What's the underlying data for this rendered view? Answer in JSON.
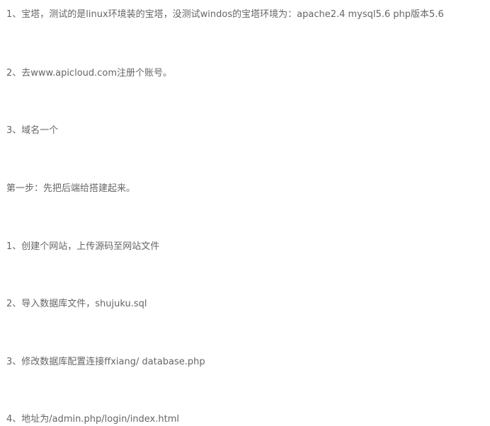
{
  "document": {
    "lines": [
      "1、宝塔，测试的是linux环境装的宝塔，没测试windos的宝塔环境为：apache2.4 mysql5.6 php版本5.6",
      "2、去www.apicloud.com注册个账号。",
      "3、域名一个",
      "第一步：先把后端给搭建起来。",
      "1、创建个网站，上传源码至网站文件",
      "2、导入数据库文件，shujuku.sql",
      "3、修改数据库配置连接ffxiang/ database.php",
      "4、地址为/admin.php/login/index.html"
    ]
  }
}
